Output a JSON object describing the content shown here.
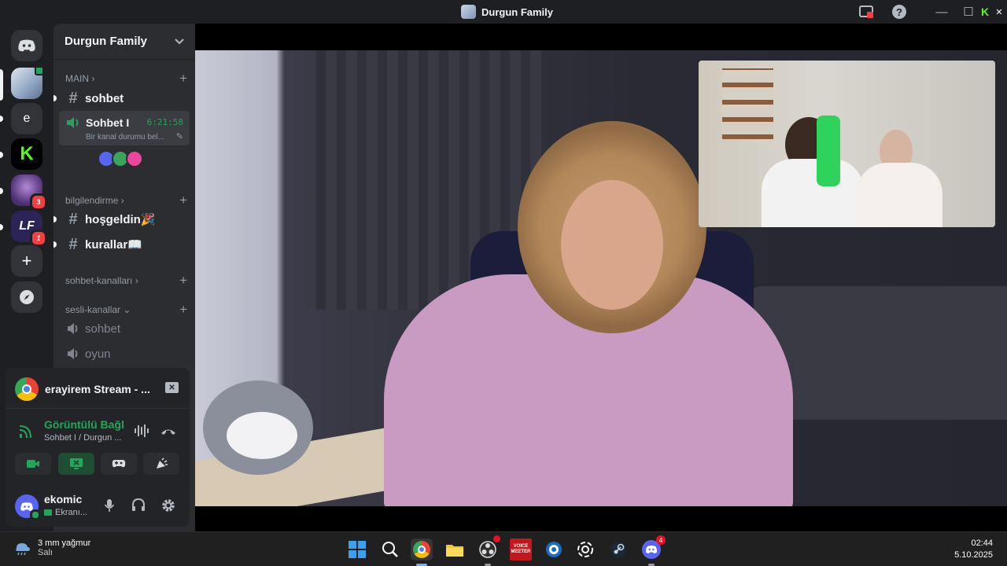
{
  "window": {
    "title": "Durgun Family",
    "controls": {
      "minimize": "—",
      "maximize": "☐",
      "close": "✕"
    }
  },
  "guilds": [
    {
      "name": "Durgun Family",
      "icon": "server-photo-icon",
      "selected": true
    },
    {
      "label": "e",
      "icon": "e-letter-icon"
    },
    {
      "label": "K",
      "icon": "kick-logo-icon"
    },
    {
      "label": "",
      "icon": "character-server-icon",
      "badge": "3"
    },
    {
      "label": "LF",
      "icon": "lf-logo-icon",
      "badge": "1"
    },
    {
      "label": "+",
      "icon": "add-server-icon"
    },
    {
      "label": "",
      "icon": "explore-compass-icon"
    }
  ],
  "server": {
    "name": "Durgun Family"
  },
  "categories": {
    "main": "MAIN",
    "bilgilendirme": "bilgilendirme",
    "sohbet_kanallari": "sohbet-kanalları",
    "sesli_kanallar": "sesli-kanallar"
  },
  "channels": {
    "sohbet_text": "sohbet",
    "voice_active": {
      "name": "Sohbet I",
      "timer": "6:21:58",
      "status": "Bir kanal durumu bel..."
    },
    "hosgeldin": "hoşgeldin🎉",
    "kurallar": "kurallar📖",
    "voice_sohbet": "sohbet",
    "voice_oyun": "oyun"
  },
  "stream": {
    "title": "erayirem Stream - ..."
  },
  "connection": {
    "status": "Görüntülü Bağl",
    "location": "Sohbet I / Durgun ..."
  },
  "user": {
    "name": "ekomic",
    "status": "Ekranı..."
  },
  "taskbar": {
    "weather": {
      "temp": "3 mm yağmur",
      "day": "Salı"
    },
    "apps": [
      "windows-start-icon",
      "search-icon",
      "chrome-icon",
      "file-explorer-icon",
      "obs-icon",
      "voicemeeter-icon",
      "app-circle-icon",
      "chatgpt-icon",
      "steam-icon",
      "discord-icon"
    ],
    "voicemeeter_label": "VOICE\nMEETER",
    "discord_badge": "4",
    "clock": {
      "time": "02:44",
      "date": "5.10.2025"
    }
  },
  "colors": {
    "accent": "#5865f2",
    "green": "#23a55a",
    "red": "#f23f43",
    "kick": "#53fc18"
  }
}
